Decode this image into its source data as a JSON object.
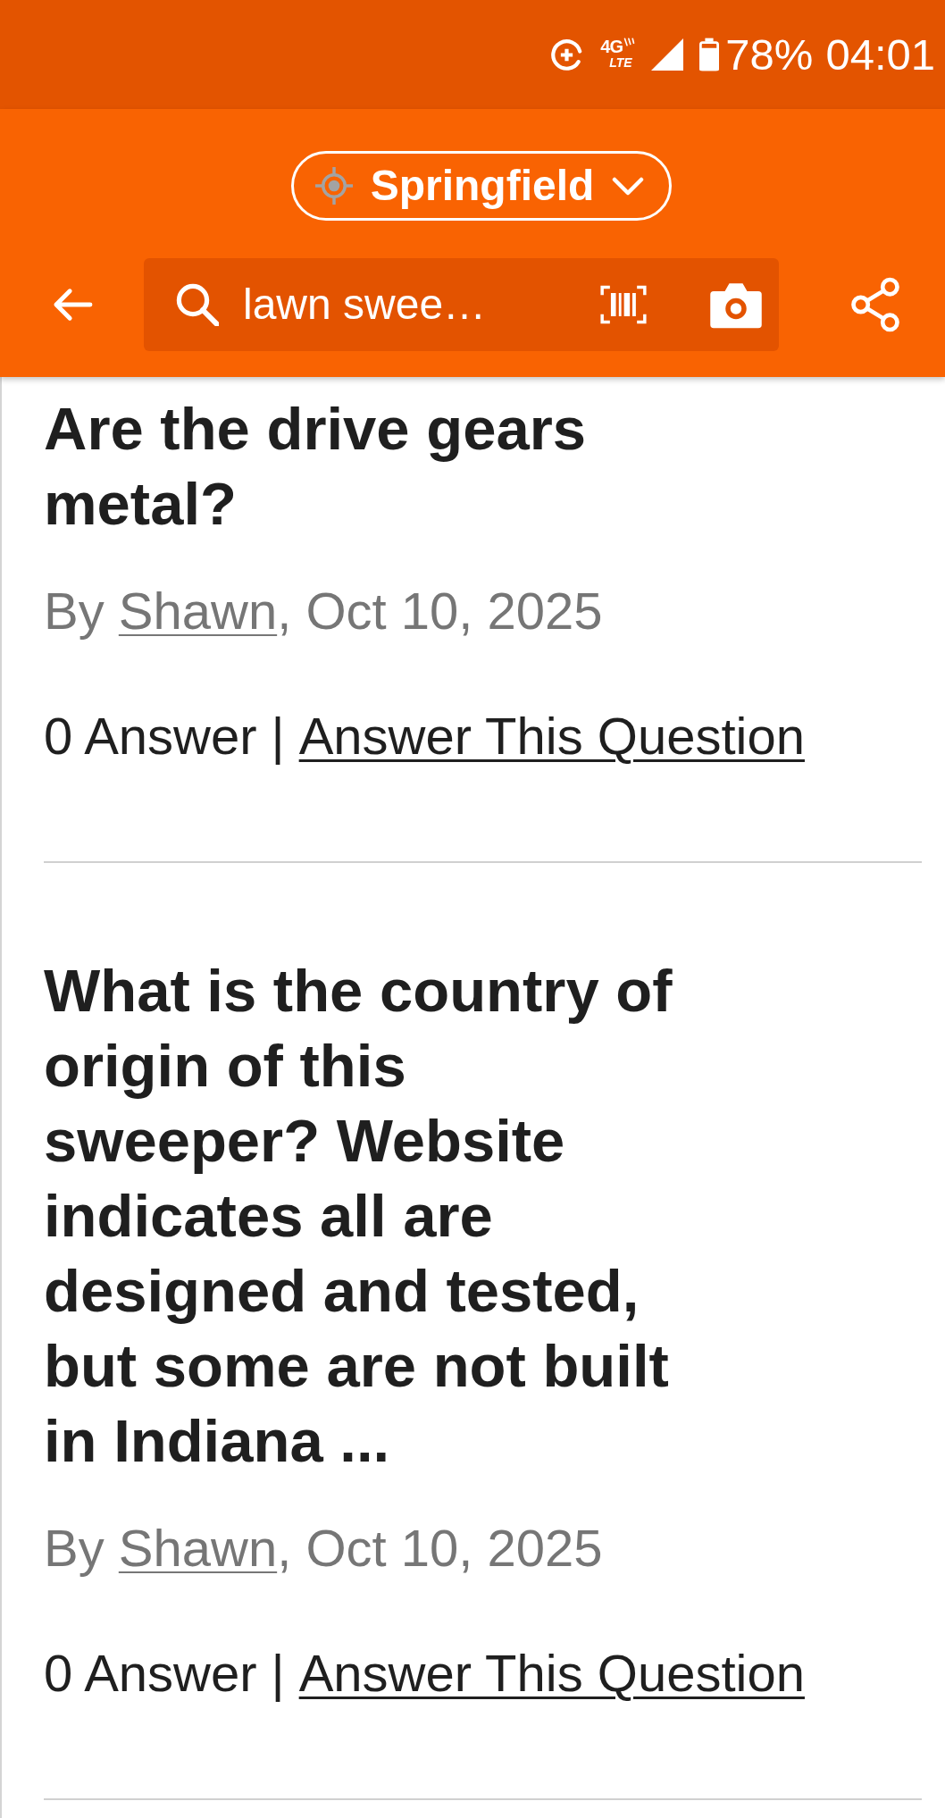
{
  "status_bar": {
    "network_type": "4G",
    "network_subtype": "LTE",
    "battery": "78%",
    "time": "04:01"
  },
  "header": {
    "location": "Springfield",
    "search": {
      "value": "lawn swee…"
    }
  },
  "questions": [
    {
      "title": "Are the drive gears metal?",
      "byline": {
        "prefix": "By",
        "author": "Shawn",
        "suffix": ", Oct 10, 2025"
      },
      "answer_count": "0 Answer",
      "separator": "|",
      "answer_link": "Answer This Question"
    },
    {
      "title": "What is the country of origin of this sweeper? Website indicates all are designed and tested, but some are not built in Indiana ...",
      "byline": {
        "prefix": "By",
        "author": "Shawn",
        "suffix": ", Oct 10, 2025"
      },
      "answer_count": "0 Answer",
      "separator": "|",
      "answer_link": "Answer This Question"
    }
  ]
}
